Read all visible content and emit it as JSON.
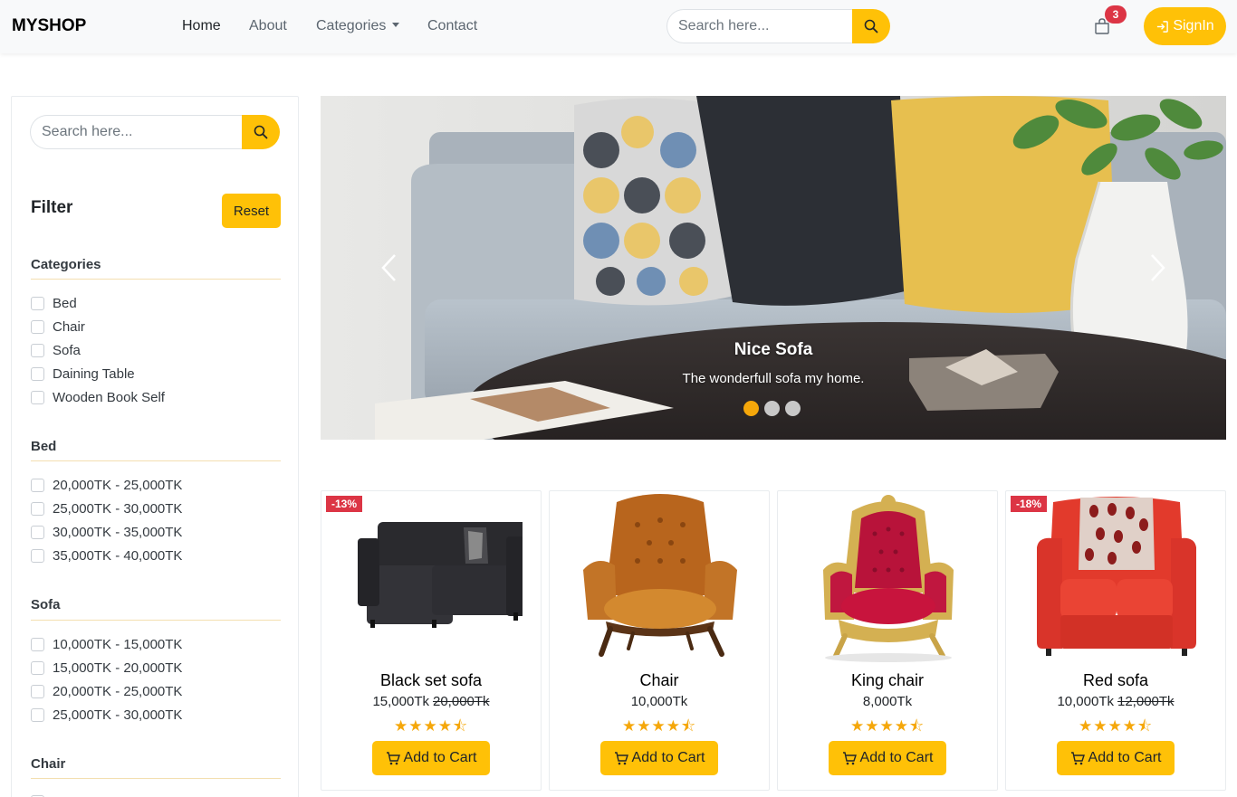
{
  "navbar": {
    "brand": "MYSHOP",
    "links": [
      "Home",
      "About",
      "Categories",
      "Contact"
    ],
    "search_placeholder": "Search here...",
    "cart_count": "3",
    "signin_label": "SignIn"
  },
  "sidebar": {
    "search_placeholder": "Search here...",
    "filter_title": "Filter",
    "reset_label": "Reset",
    "sections": [
      {
        "title": "Categories",
        "items": [
          "Bed",
          "Chair",
          "Sofa",
          "Daining Table",
          "Wooden Book Self"
        ]
      },
      {
        "title": "Bed",
        "items": [
          "20,000TK - 25,000TK",
          "25,000TK - 30,000TK",
          "30,000TK - 35,000TK",
          "35,000TK - 40,000TK"
        ]
      },
      {
        "title": "Sofa",
        "items": [
          "10,000TK - 15,000TK",
          "15,000TK - 20,000TK",
          "20,000TK - 25,000TK",
          "25,000TK - 30,000TK"
        ]
      },
      {
        "title": "Chair",
        "items": []
      }
    ]
  },
  "carousel": {
    "title": "Nice Sofa",
    "subtitle": "The wonderfull sofa my home.",
    "slide_count": 3,
    "active_slide": 0
  },
  "products": [
    {
      "name": "Black set sofa",
      "price": "15,000Tk",
      "old_price": "20,000Tk",
      "discount": "-13%",
      "rating": 4.5,
      "add_label": "Add to Cart"
    },
    {
      "name": "Chair",
      "price": "10,000Tk",
      "old_price": "",
      "discount": "",
      "rating": 4.5,
      "add_label": "Add to Cart"
    },
    {
      "name": "King chair",
      "price": "8,000Tk",
      "old_price": "",
      "discount": "",
      "rating": 4.5,
      "add_label": "Add to Cart"
    },
    {
      "name": "Red sofa",
      "price": "10,000Tk",
      "old_price": "12,000Tk",
      "discount": "-18%",
      "rating": 4.5,
      "add_label": "Add to Cart"
    }
  ],
  "colors": {
    "accent": "#ffc107",
    "badge": "#dc3545",
    "star": "#f5a70a"
  }
}
